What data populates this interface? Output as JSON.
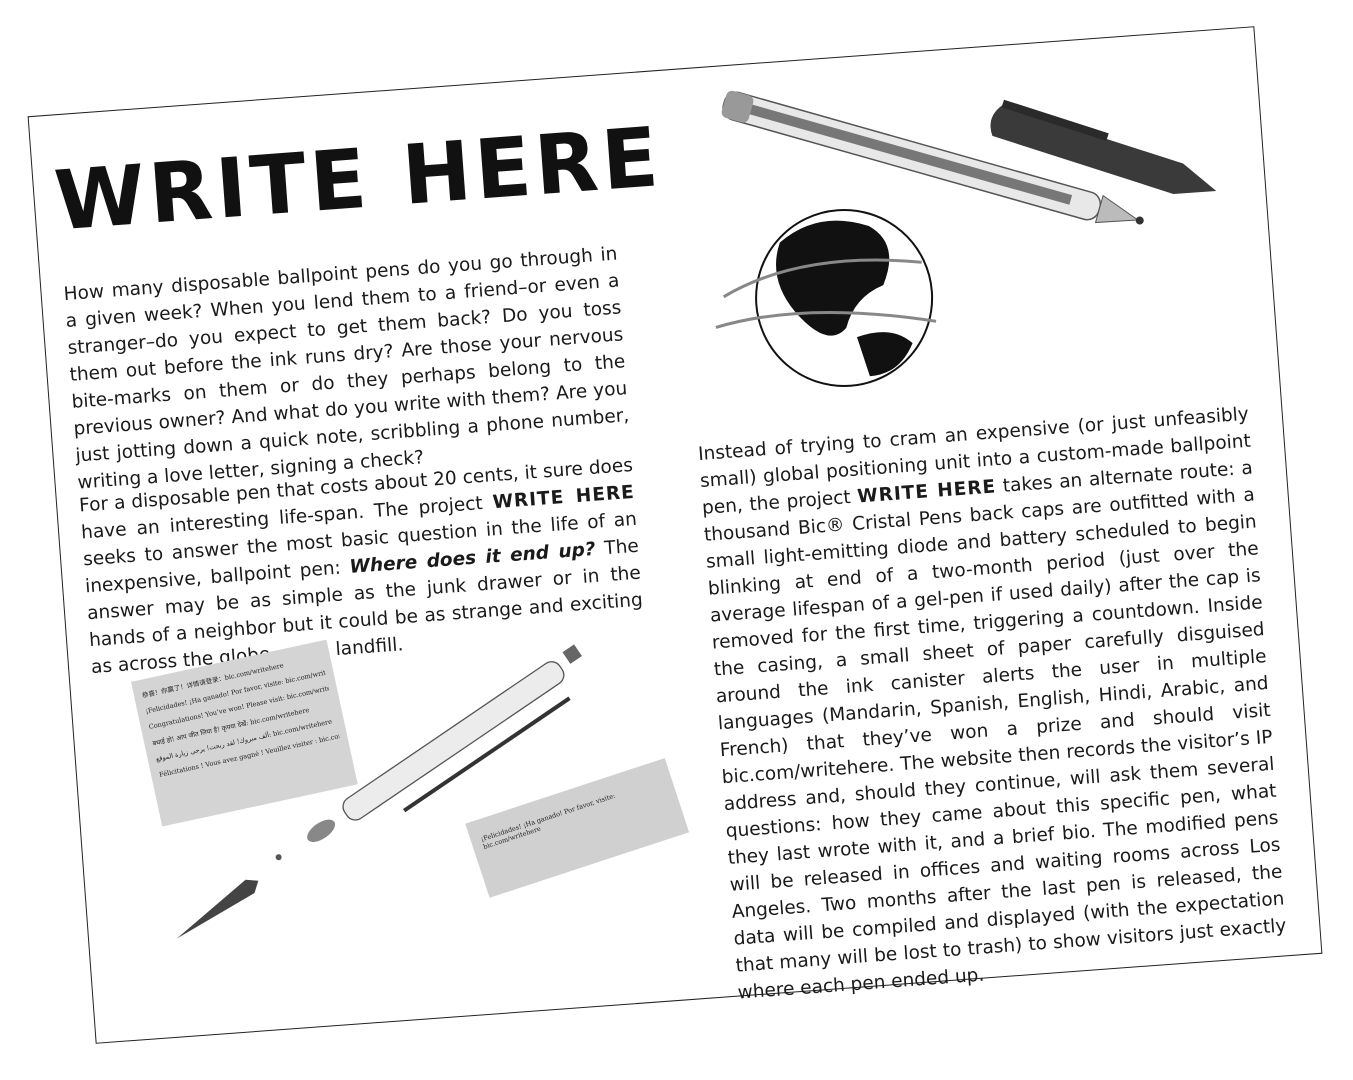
{
  "title": "WRITE HERE",
  "para1": "How many disposable ballpoint pens do you go through in a given week? When you lend them to a friend–or even a stranger–do you expect to get them back? Do you toss them out before the ink runs dry? Are those your nervous bite-marks on them or do they perhaps belong to the previous owner? And what do you write with them? Are you just jotting down a quick note, scribbling a phone number, writing a love letter, signing a check?",
  "para2": {
    "a": "For a disposable pen that costs about 20 cents, it sure does have an interesting life-span. The project ",
    "kw": "WRITE HERE",
    "b": " seeks to answer the most basic question in the life of an inexpensive, ballpoint pen: ",
    "q": "Where does it end up?",
    "c": " The answer may be as simple as the junk drawer or in the hands of a neighbor but it could be as strange and exciting as across the globe... or a landfill."
  },
  "para3": {
    "a": "Instead of trying to cram an expensive (or just unfeasibly small) global positioning unit into a custom-made ballpoint pen, the project ",
    "kw": "WRITE HERE",
    "b": " takes an alternate route: a thousand Bic® Cristal Pens back caps are outfitted with a small light-emitting diode and battery scheduled to begin blinking at end of a two-month period (just over the average lifespan of a gel-pen if used daily) after the cap is removed for the first time, triggering a countdown. Inside the casing, a small sheet of paper carefully disguised around the ink canister alerts the user in multiple languages (Mandarin, Spanish, English, Hindi, Arabic, and French) that they’ve won a prize and should visit bic.com/writehere. The website then records the visitor’s IP address and, should they continue, will ask them several questions: how they came about this specific pen, what they last wrote with it, and a brief bio. The modified pens will be released in offices and waiting rooms across Los Angeles. Two months after the last pen is released, the data will be compiled and displayed (with the expectation that many will be lost to trash) to show visitors just exactly where each pen ended up."
  },
  "note_lines": [
    "恭喜！你赢了！详情请登录：bic.com/writehere",
    "¡Felicidades! ¡Ha ganado! Por favor, visite: bic.com/writehere",
    "Congratulations! You’ve won! Please visit: bic.com/writehere",
    "बधाई हो! आप जीत लिया है! कृपया देखें: bic.com/writehere",
    "ألف مبروك! لقد ربحت! يرجى زيارة الموقع: bic.com/writehere",
    "Félicitations ! Vous avez gagné ! Veuillez visiter : bic.com/writehere"
  ],
  "strip_line": "¡Felicidades! ¡Ha ganado! Por favor, visite: bic.com/writehere",
  "colors": {
    "ink": "#111111",
    "paper": "#ffffff",
    "note_gray": "#d4d4d4"
  },
  "icons": [
    "ballpoint-pen-icon",
    "pen-cap-icon",
    "globe-icon",
    "pen-parts-icon"
  ]
}
